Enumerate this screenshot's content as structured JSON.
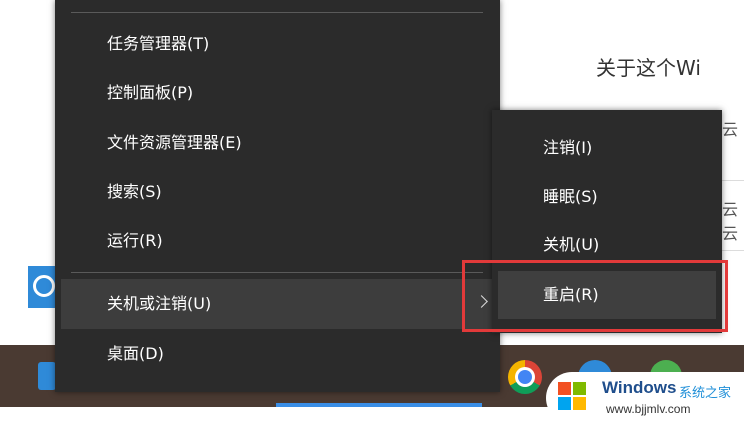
{
  "background": {
    "heading": "关于这个Wi",
    "fragments": [
      "云",
      "云",
      "云"
    ]
  },
  "menu": {
    "items": [
      {
        "label": "任务管理器(T)"
      },
      {
        "label": "控制面板(P)"
      },
      {
        "label": "文件资源管理器(E)"
      },
      {
        "label": "搜索(S)"
      },
      {
        "label": "运行(R)"
      },
      {
        "label": "关机或注销(U)"
      },
      {
        "label": "桌面(D)"
      }
    ]
  },
  "submenu": {
    "items": [
      {
        "label": "注销(I)"
      },
      {
        "label": "睡眠(S)"
      },
      {
        "label": "关机(U)"
      },
      {
        "label": "重启(R)"
      }
    ]
  },
  "watermark": {
    "title": "Windows",
    "subtitle": "系统之家",
    "url": "www.bjjmlv.com"
  },
  "colors": {
    "menu_bg": "#2b2b2b",
    "highlight_border": "#e23a3a",
    "taskbar": "#4a3a32"
  }
}
